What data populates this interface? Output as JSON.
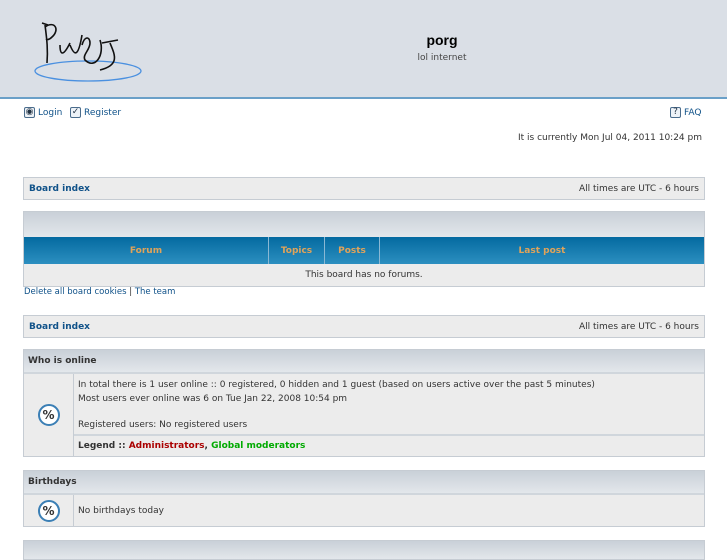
{
  "header": {
    "title": "porg",
    "description": "lol internet",
    "logo_text": "Porg"
  },
  "nav": {
    "login": "Login",
    "register": "Register",
    "faq": "FAQ"
  },
  "current_time": "It is currently Mon Jul 04, 2011 10:24 pm",
  "breadcrumb": {
    "board_index": "Board index",
    "timezone": "All times are UTC - 6 hours"
  },
  "forum_table": {
    "columns": [
      "Forum",
      "Topics",
      "Posts",
      "Last post"
    ],
    "empty_message": "This board has no forums."
  },
  "footer_links": {
    "delete_cookies": "Delete all board cookies",
    "separator": " | ",
    "team": "The team"
  },
  "who_is_online": {
    "title": "Who is online",
    "total": "In total there is 1 user online :: 0 registered, 0 hidden and 1 guest (based on users active over the past 5 minutes)",
    "most": "Most users ever online was 6 on Tue Jan 22, 2008 10:54 pm",
    "registered": "Registered users: No registered users",
    "legend_label": "Legend :: ",
    "legend_admins": "Administrators",
    "legend_sep": ", ",
    "legend_mods": "Global moderators",
    "colors": {
      "admin": "#AA0000",
      "mod": "#00AA00"
    }
  },
  "birthdays": {
    "title": "Birthdays",
    "message": "No birthdays today"
  }
}
